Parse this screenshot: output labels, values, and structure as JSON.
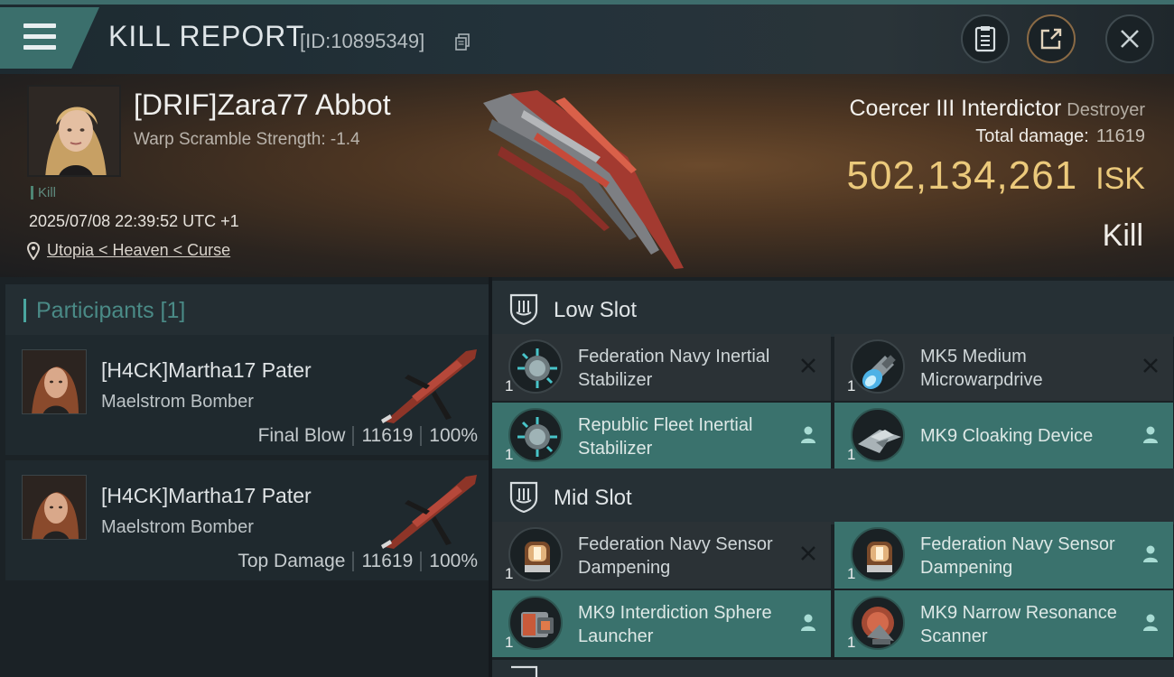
{
  "header": {
    "title": "KILL REPORT",
    "report_id": "[ID:10895349]"
  },
  "victim": {
    "name": "[DRIF]Zara77 Abbot",
    "subtitle": "Warp Scramble Strength: -1.4",
    "tag": "Kill",
    "time": "2025/07/08 22:39:52 UTC +1",
    "location": "Utopia < Heaven < Curse",
    "ship_name": "Coercer III Interdictor",
    "ship_class": "Destroyer",
    "total_damage_label": "Total damage:",
    "total_damage": "11619",
    "isk_value": "502,134,261",
    "isk_unit": "ISK",
    "result": "Kill"
  },
  "participants": {
    "title": "Participants [1]",
    "rows": [
      {
        "name": "[H4CK]Martha17 Pater",
        "ship": "Maelstrom Bomber",
        "role": "Final Blow",
        "damage": "11619",
        "percent": "100%"
      },
      {
        "name": "[H4CK]Martha17 Pater",
        "ship": "Maelstrom Bomber",
        "role": "Top Damage",
        "damage": "11619",
        "percent": "100%"
      }
    ]
  },
  "fitting": {
    "low_slot": {
      "title": "Low Slot",
      "modules": [
        {
          "name": "Federation Navy Inertial Stabilizer",
          "qty": "1",
          "state": "destroyed"
        },
        {
          "name": "MK5 Medium Microwarpdrive",
          "qty": "1",
          "state": "destroyed"
        },
        {
          "name": "Republic Fleet Inertial Stabilizer",
          "qty": "1",
          "state": "dropped"
        },
        {
          "name": "MK9 Cloaking Device",
          "qty": "1",
          "state": "dropped"
        }
      ]
    },
    "mid_slot": {
      "title": "Mid Slot",
      "modules": [
        {
          "name": "Federation Navy Sensor Dampening",
          "qty": "1",
          "state": "destroyed"
        },
        {
          "name": "Federation Navy Sensor Dampening",
          "qty": "1",
          "state": "dropped"
        },
        {
          "name": "MK9 Interdiction Sphere Launcher",
          "qty": "1",
          "state": "dropped"
        },
        {
          "name": "MK9 Narrow Resonance Scanner",
          "qty": "1",
          "state": "dropped"
        }
      ]
    }
  },
  "colors": {
    "accent_teal": "#3a726d",
    "isk_gold": "#ebc97b",
    "panel_dark": "#2b3236"
  },
  "icons": [
    "menu-icon",
    "copy-icon",
    "clipboard-icon",
    "share-icon",
    "close-icon",
    "location-pin-icon",
    "shield-icon",
    "destroyed-x-icon",
    "dropped-person-icon"
  ]
}
